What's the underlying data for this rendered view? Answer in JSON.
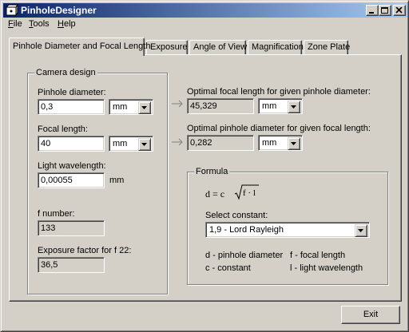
{
  "window": {
    "title": "PinholeDesigner",
    "icon": "camera-app-icon"
  },
  "menu": {
    "items": [
      {
        "label": "File",
        "mnemonic": "F"
      },
      {
        "label": "Tools",
        "mnemonic": "T"
      },
      {
        "label": "Help",
        "mnemonic": "H"
      }
    ]
  },
  "tabs": [
    {
      "label": "Pinhole Diameter and Focal Length",
      "active": true
    },
    {
      "label": "Exposure",
      "active": false
    },
    {
      "label": "Angle of View",
      "active": false
    },
    {
      "label": "Magnification",
      "active": false
    },
    {
      "label": "Zone Plate",
      "active": false
    }
  ],
  "camera_design": {
    "legend": "Camera design",
    "pinhole_diameter": {
      "label": "Pinhole diameter:",
      "value": "0,3",
      "unit": "mm"
    },
    "focal_length": {
      "label": "Focal length:",
      "value": "40",
      "unit": "mm"
    },
    "wavelength": {
      "label": "Light wavelength:",
      "value": "0,00055",
      "unit": "mm"
    },
    "f_number": {
      "label": "f number:",
      "value": "133"
    },
    "exposure_factor": {
      "label": "Exposure factor for f 22:",
      "value": "36,5"
    }
  },
  "results": {
    "optimal_focal": {
      "label": "Optimal focal length for given pinhole diameter:",
      "value": "45,329",
      "unit": "mm"
    },
    "optimal_pinhole": {
      "label": "Optimal pinhole diameter for given focal length:",
      "value": "0,282",
      "unit": "mm"
    }
  },
  "formula": {
    "legend": "Formula",
    "lhs": "d = c",
    "radicand": "f · l",
    "select_label": "Select constant:",
    "constant_value": "1,9 - Lord Rayleigh",
    "legend_rows": [
      {
        "left": "d - pinhole diameter",
        "right": "f - focal length"
      },
      {
        "left": "c - constant",
        "right": "l - light wavelength"
      }
    ]
  },
  "buttons": {
    "exit": "Exit"
  }
}
